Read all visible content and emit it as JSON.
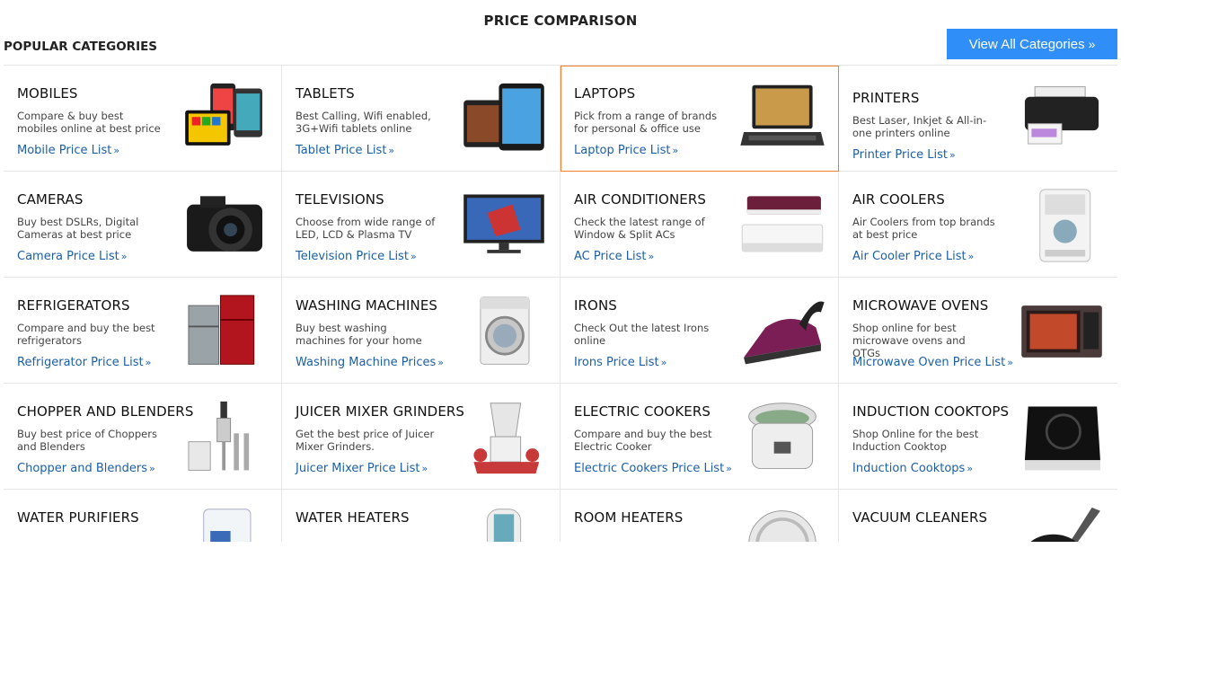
{
  "header": {
    "title": "PRICE COMPARISON",
    "section_title": "POPULAR CATEGORIES",
    "view_all_label": "View All Categories",
    "view_all_icon": "double-chevron-right-icon",
    "accent_color": "#2f8ef7",
    "highlight_color": "#f08030",
    "link_color": "#1b5fa8"
  },
  "categories": [
    {
      "key": "mobiles",
      "title": "MOBILES",
      "desc": "Compare & buy best mobiles online at best price",
      "link": "Mobile Price List",
      "icon": "smartphones-icon"
    },
    {
      "key": "tablets",
      "title": "TABLETS",
      "desc": "Best Calling, Wifi enabled, 3G+Wifi tablets online",
      "link": "Tablet Price List",
      "icon": "tablets-icon"
    },
    {
      "key": "laptops",
      "title": "LAPTOPS",
      "desc": "Pick from a range of brands for personal & office use",
      "link": "Laptop Price List",
      "icon": "laptop-icon",
      "highlighted": true
    },
    {
      "key": "printers",
      "title": "PRINTERS",
      "desc": "Best Laser, Inkjet & All-in-one printers online",
      "link": "Printer Price List",
      "icon": "printer-icon"
    },
    {
      "key": "cameras",
      "title": "CAMERAS",
      "desc": "Buy best DSLRs, Digital Cameras at best price",
      "link": "Camera Price List",
      "icon": "camera-icon"
    },
    {
      "key": "televisions",
      "title": "TELEVISIONS",
      "desc": "Choose from wide range of LED, LCD & Plasma TV",
      "link": "Television Price List",
      "icon": "television-icon"
    },
    {
      "key": "air-conditioners",
      "title": "AIR CONDITIONERS",
      "desc": "Check the latest range of Window & Split ACs",
      "link": "AC Price List",
      "icon": "air-conditioner-icon"
    },
    {
      "key": "air-coolers",
      "title": "AIR COOLERS",
      "desc": "Air Coolers from top brands at best price",
      "link": "Air Cooler Price List",
      "icon": "air-cooler-icon"
    },
    {
      "key": "refrigerators",
      "title": "REFRIGERATORS",
      "desc": "Compare and buy the best refrigerators",
      "link": "Refrigerator Price List",
      "icon": "refrigerator-icon"
    },
    {
      "key": "washing-machines",
      "title": "WASHING MACHINES",
      "desc": "Buy best washing machines for your home",
      "link": "Washing Machine Prices",
      "icon": "washing-machine-icon"
    },
    {
      "key": "irons",
      "title": "IRONS",
      "desc": "Check Out the latest Irons online",
      "link": "Irons Price List",
      "icon": "iron-icon"
    },
    {
      "key": "microwave-ovens",
      "title": "MICROWAVE OVENS",
      "desc": "Shop online for best microwave ovens and OTGs",
      "link": "Microwave Oven Price List",
      "icon": "microwave-icon"
    },
    {
      "key": "chopper-blenders",
      "title": "CHOPPER AND BLENDERS",
      "desc": "Buy best price of Choppers and Blenders",
      "link": "Chopper and Blenders",
      "icon": "blender-icon"
    },
    {
      "key": "juicer-mixer",
      "title": "JUICER MIXER GRINDERS",
      "desc": "Get the best price of Juicer Mixer Grinders.",
      "link": "Juicer Mixer Price List",
      "icon": "mixer-grinder-icon"
    },
    {
      "key": "electric-cookers",
      "title": "ELECTRIC COOKERS",
      "desc": "Compare and buy the best Electric Cooker",
      "link": "Electric Cookers Price List",
      "icon": "rice-cooker-icon"
    },
    {
      "key": "induction-cooktops",
      "title": "INDUCTION COOKTOPS",
      "desc": "Shop Online for the best Induction Cooktop",
      "link": "Induction Cooktops",
      "icon": "induction-cooktop-icon"
    },
    {
      "key": "water-purifiers",
      "title": "WATER PURIFIERS",
      "desc": "",
      "link": "",
      "icon": "water-purifier-icon"
    },
    {
      "key": "water-heaters",
      "title": "WATER HEATERS",
      "desc": "",
      "link": "",
      "icon": "water-heater-icon"
    },
    {
      "key": "room-heaters",
      "title": "ROOM HEATERS",
      "desc": "",
      "link": "",
      "icon": "room-heater-icon"
    },
    {
      "key": "vacuum-cleaners",
      "title": "VACUUM CLEANERS",
      "desc": "",
      "link": "",
      "icon": "vacuum-cleaner-icon"
    }
  ]
}
